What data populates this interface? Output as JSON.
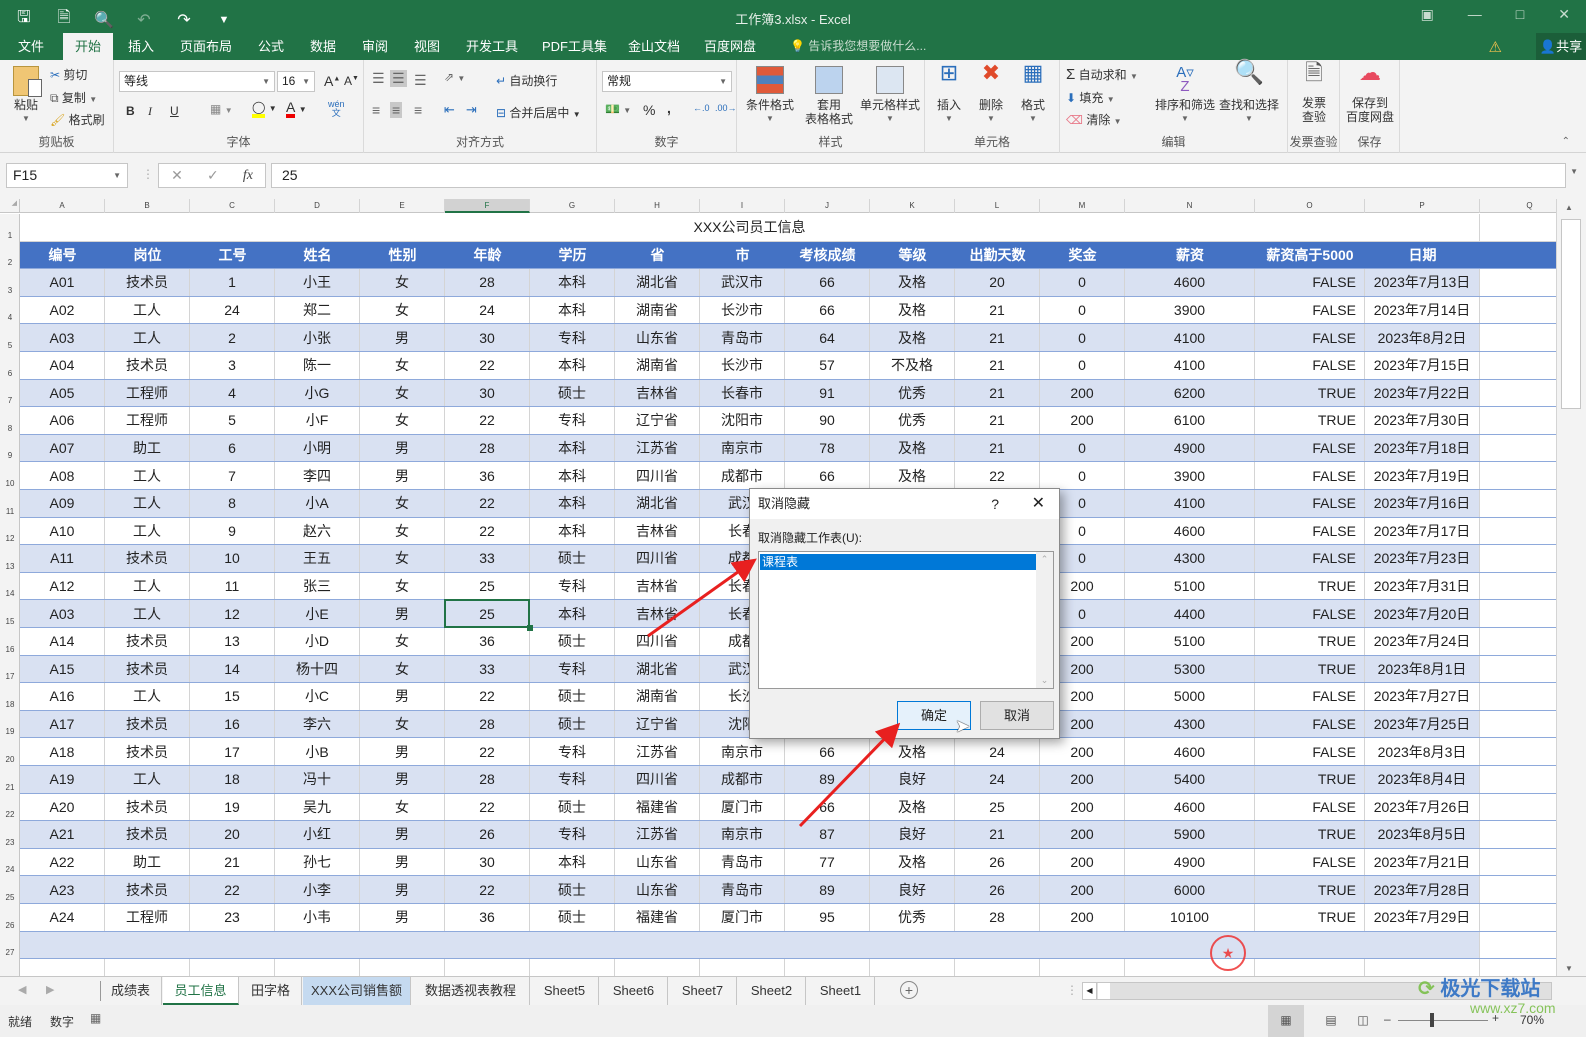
{
  "window": {
    "title": "工作簿3.xlsx - Excel",
    "qat_icons": [
      "save-icon",
      "print-preview-icon",
      "print-icon",
      "undo-icon",
      "redo-icon",
      "customize-icon"
    ],
    "controls": [
      "ribbon-display-icon",
      "minimize-icon",
      "maximize-icon",
      "close-icon"
    ]
  },
  "tabs": [
    "文件",
    "开始",
    "插入",
    "页面布局",
    "公式",
    "数据",
    "审阅",
    "视图",
    "开发工具",
    "PDF工具集",
    "金山文档",
    "百度网盘"
  ],
  "active_tab": "开始",
  "tell_me": "告诉我您想要做什么...",
  "share": "共享",
  "ribbon": {
    "clipboard": {
      "label": "剪贴板",
      "paste": "粘贴",
      "cut": "剪切",
      "copy": "复制",
      "format_painter": "格式刷"
    },
    "font": {
      "label": "字体",
      "font_name": "等线",
      "font_size": "16",
      "bold": "B",
      "italic": "I",
      "underline": "U",
      "grow": "A",
      "shrink": "A",
      "phonetic": "wén"
    },
    "alignment": {
      "label": "对齐方式",
      "wrap": "自动换行",
      "merge": "合并后居中"
    },
    "number": {
      "label": "数字",
      "format": "常规",
      "percent": "%",
      "comma": ","
    },
    "styles": {
      "label": "样式",
      "conditional": "条件格式",
      "table_line1": "套用",
      "table_line2": "表格格式",
      "cell_styles": "单元格样式"
    },
    "cells": {
      "label": "单元格",
      "insert": "插入",
      "delete": "删除",
      "format": "格式"
    },
    "editing": {
      "label": "编辑",
      "autosum": "自动求和",
      "fill": "填充",
      "clear": "清除",
      "sort": "排序和筛选",
      "find": "查找和选择"
    },
    "invoice": {
      "label": "发票查验",
      "btn_line1": "发票",
      "btn_line2": "查验"
    },
    "save": {
      "label": "保存",
      "btn_line1": "保存到",
      "btn_line2": "百度网盘"
    }
  },
  "formula_bar": {
    "name_box": "F15",
    "formula": "25",
    "fx": "fx"
  },
  "columns": [
    "A",
    "B",
    "C",
    "D",
    "E",
    "F",
    "G",
    "H",
    "I",
    "J",
    "K",
    "L",
    "M",
    "N",
    "O",
    "P",
    "Q"
  ],
  "selected_column": "F",
  "sheet": {
    "title": "XXX公司员工信息",
    "headers": [
      "编号",
      "岗位",
      "工号",
      "姓名",
      "性别",
      "年龄",
      "学历",
      "省",
      "市",
      "考核成绩",
      "等级",
      "出勤天数",
      "奖金",
      "薪资",
      "薪资高于5000",
      "日期"
    ],
    "rows": [
      [
        "A01",
        "技术员",
        "1",
        "小王",
        "女",
        "28",
        "本科",
        "湖北省",
        "武汉市",
        "66",
        "及格",
        "20",
        "0",
        "4600",
        "FALSE",
        "2023年7月13日"
      ],
      [
        "A02",
        "工人",
        "24",
        "郑二",
        "女",
        "24",
        "本科",
        "湖南省",
        "长沙市",
        "66",
        "及格",
        "21",
        "0",
        "3900",
        "FALSE",
        "2023年7月14日"
      ],
      [
        "A03",
        "工人",
        "2",
        "小张",
        "男",
        "30",
        "专科",
        "山东省",
        "青岛市",
        "64",
        "及格",
        "21",
        "0",
        "4100",
        "FALSE",
        "2023年8月2日"
      ],
      [
        "A04",
        "技术员",
        "3",
        "陈一",
        "女",
        "22",
        "本科",
        "湖南省",
        "长沙市",
        "57",
        "不及格",
        "21",
        "0",
        "4100",
        "FALSE",
        "2023年7月15日"
      ],
      [
        "A05",
        "工程师",
        "4",
        "小G",
        "女",
        "30",
        "硕士",
        "吉林省",
        "长春市",
        "91",
        "优秀",
        "21",
        "200",
        "6200",
        "TRUE",
        "2023年7月22日"
      ],
      [
        "A06",
        "工程师",
        "5",
        "小F",
        "女",
        "22",
        "专科",
        "辽宁省",
        "沈阳市",
        "90",
        "优秀",
        "21",
        "200",
        "6100",
        "TRUE",
        "2023年7月30日"
      ],
      [
        "A07",
        "助工",
        "6",
        "小明",
        "男",
        "28",
        "本科",
        "江苏省",
        "南京市",
        "78",
        "及格",
        "21",
        "0",
        "4900",
        "FALSE",
        "2023年7月18日"
      ],
      [
        "A08",
        "工人",
        "7",
        "李四",
        "男",
        "36",
        "本科",
        "四川省",
        "成都市",
        "66",
        "及格",
        "22",
        "0",
        "3900",
        "FALSE",
        "2023年7月19日"
      ],
      [
        "A09",
        "工人",
        "8",
        "小A",
        "女",
        "22",
        "本科",
        "湖北省",
        "武汉",
        "",
        "",
        "",
        "0",
        "4100",
        "FALSE",
        "2023年7月16日"
      ],
      [
        "A10",
        "工人",
        "9",
        "赵六",
        "女",
        "22",
        "本科",
        "吉林省",
        "长春",
        "",
        "",
        "",
        "0",
        "4600",
        "FALSE",
        "2023年7月17日"
      ],
      [
        "A11",
        "技术员",
        "10",
        "王五",
        "女",
        "33",
        "硕士",
        "四川省",
        "成都",
        "",
        "",
        "",
        "0",
        "4300",
        "FALSE",
        "2023年7月23日"
      ],
      [
        "A12",
        "工人",
        "11",
        "张三",
        "女",
        "25",
        "专科",
        "吉林省",
        "长春",
        "",
        "",
        "",
        "200",
        "5100",
        "TRUE",
        "2023年7月31日"
      ],
      [
        "A03",
        "工人",
        "12",
        "小E",
        "男",
        "25",
        "本科",
        "吉林省",
        "长春",
        "",
        "",
        "",
        "0",
        "4400",
        "FALSE",
        "2023年7月20日"
      ],
      [
        "A14",
        "技术员",
        "13",
        "小D",
        "女",
        "36",
        "硕士",
        "四川省",
        "成都",
        "",
        "",
        "",
        "200",
        "5100",
        "TRUE",
        "2023年7月24日"
      ],
      [
        "A15",
        "技术员",
        "14",
        "杨十四",
        "女",
        "33",
        "专科",
        "湖北省",
        "武汉",
        "",
        "",
        "",
        "200",
        "5300",
        "TRUE",
        "2023年8月1日"
      ],
      [
        "A16",
        "工人",
        "15",
        "小C",
        "男",
        "22",
        "硕士",
        "湖南省",
        "长沙",
        "",
        "",
        "",
        "200",
        "5000",
        "FALSE",
        "2023年7月27日"
      ],
      [
        "A17",
        "技术员",
        "16",
        "李六",
        "女",
        "28",
        "硕士",
        "辽宁省",
        "沈阳",
        "",
        "",
        "",
        "200",
        "4300",
        "FALSE",
        "2023年7月25日"
      ],
      [
        "A18",
        "技术员",
        "17",
        "小B",
        "男",
        "22",
        "专科",
        "江苏省",
        "南京市",
        "66",
        "及格",
        "24",
        "200",
        "4600",
        "FALSE",
        "2023年8月3日"
      ],
      [
        "A19",
        "工人",
        "18",
        "冯十",
        "男",
        "28",
        "专科",
        "四川省",
        "成都市",
        "89",
        "良好",
        "24",
        "200",
        "5400",
        "TRUE",
        "2023年8月4日"
      ],
      [
        "A20",
        "技术员",
        "19",
        "吴九",
        "女",
        "22",
        "硕士",
        "福建省",
        "厦门市",
        "66",
        "及格",
        "25",
        "200",
        "4600",
        "FALSE",
        "2023年7月26日"
      ],
      [
        "A21",
        "技术员",
        "20",
        "小红",
        "男",
        "26",
        "专科",
        "江苏省",
        "南京市",
        "87",
        "良好",
        "21",
        "200",
        "5900",
        "TRUE",
        "2023年8月5日"
      ],
      [
        "A22",
        "助工",
        "21",
        "孙七",
        "男",
        "30",
        "本科",
        "山东省",
        "青岛市",
        "77",
        "及格",
        "26",
        "200",
        "4900",
        "FALSE",
        "2023年7月21日"
      ],
      [
        "A23",
        "技术员",
        "22",
        "小李",
        "男",
        "22",
        "硕士",
        "山东省",
        "青岛市",
        "89",
        "良好",
        "26",
        "200",
        "6000",
        "TRUE",
        "2023年7月28日"
      ],
      [
        "A24",
        "工程师",
        "23",
        "小韦",
        "男",
        "36",
        "硕士",
        "福建省",
        "厦门市",
        "95",
        "优秀",
        "28",
        "200",
        "10100",
        "TRUE",
        "2023年7月29日"
      ]
    ]
  },
  "sheet_tabs": [
    "成绩表",
    "员工信息",
    "田字格",
    "XXX公司销售额",
    "数据透视表教程",
    "Sheet5",
    "Sheet6",
    "Sheet7",
    "Sheet2",
    "Sheet1"
  ],
  "active_sheet": "员工信息",
  "status": {
    "ready": "就绪",
    "mode": "数字",
    "zoom": "70%"
  },
  "dialog": {
    "title": "取消隐藏",
    "help": "?",
    "label": "取消隐藏工作表(U):",
    "items": [
      "课程表"
    ],
    "ok": "确定",
    "cancel": "取消"
  },
  "watermark": {
    "name": "极光下载站",
    "url": "www.xz7.com"
  },
  "colors": {
    "excel_green": "#217346",
    "header_blue": "#4472c4",
    "band": "#d9e1f2",
    "selection_blue": "#0078d7",
    "arrow_red": "#e8201f"
  }
}
